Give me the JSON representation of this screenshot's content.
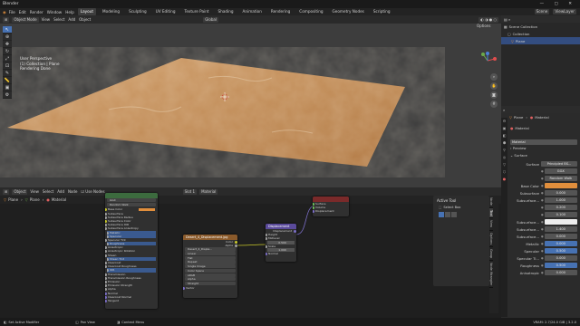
{
  "title": "Blender",
  "colors": {
    "accent": "#4772b3",
    "orange": "#e08e3c",
    "bg": "#3d3d3d",
    "node_shader": "#3c6b3e",
    "node_tex": "#8a5a2b",
    "node_vec": "#5a4a9a"
  },
  "menu": {
    "items": [
      "File",
      "Edit",
      "Render",
      "Window",
      "Help"
    ],
    "tabs": [
      "Layout",
      "Modeling",
      "Sculpting",
      "UV Editing",
      "Texture Paint",
      "Shading",
      "Animation",
      "Rendering",
      "Compositing",
      "Geometry Nodes",
      "Scripting"
    ],
    "active_tab": "Layout",
    "scene": "Scene",
    "view_layer": "ViewLayer"
  },
  "viewport": {
    "mode": "Object Mode",
    "menus": [
      "View",
      "Select",
      "Add",
      "Object"
    ],
    "orientation": "Global",
    "options": "Options",
    "info": [
      "User Perspective",
      "(1) Collection | Plane",
      "Rendering Done"
    ]
  },
  "tools": [
    "cursor-icon",
    "select-icon",
    "move-icon",
    "rotate-icon",
    "scale-icon",
    "transform-icon",
    "annotate-icon",
    "measure-icon",
    "add-icon",
    "settings-icon"
  ],
  "outliner": {
    "rows": [
      "Scene Collection",
      "Collection",
      "Plane"
    ],
    "selected": "Plane"
  },
  "properties": {
    "breadcrumb": [
      "Plane",
      "Material"
    ],
    "slot": "Material",
    "material": "Material",
    "panels": {
      "surface": "Surface",
      "preview": "Preview"
    },
    "surface_label": "Surface",
    "surface_value": "Principled BS...",
    "rows": [
      {
        "label": "",
        "value": "GGX"
      },
      {
        "label": "",
        "value": "Random Walk"
      },
      {
        "label": "Base Color",
        "value": ""
      },
      {
        "label": "Subsurface",
        "value": "0.000"
      },
      {
        "label": "Subsurface...",
        "value": "1.000"
      },
      {
        "label": "",
        "value": "0.200"
      },
      {
        "label": "",
        "value": "0.100"
      },
      {
        "label": "Subsurface...",
        "value": ""
      },
      {
        "label": "Subsurface...",
        "value": "1.400"
      },
      {
        "label": "Subsurface...",
        "value": "0.000"
      },
      {
        "label": "Metallic",
        "value": "0.000"
      },
      {
        "label": "Specular",
        "value": "0.500"
      },
      {
        "label": "Specular Ti...",
        "value": "0.000"
      },
      {
        "label": "Roughness",
        "value": "0.500"
      },
      {
        "label": "Anisotropic",
        "value": "0.000"
      }
    ]
  },
  "node_header": {
    "editor": "Object",
    "menus": [
      "View",
      "Select",
      "Add",
      "Node"
    ],
    "use_nodes": "Use Nodes",
    "slot": "Slot 1",
    "material": "Material"
  },
  "node_breadcrumb": [
    "Plane",
    "Plane",
    "Material"
  ],
  "nodes": {
    "bsdf": {
      "rows": [
        "GGX",
        "Random Walk",
        "Base Color",
        "Subsurface",
        "Subsurface Radius",
        "Subsurface Color",
        "Subsurface IOR",
        "Subsurface Anisotropy",
        "Metallic",
        "Specular",
        "Specular Tint",
        "Roughness",
        "Anisotropic",
        "Anisotropic Rotation",
        "Sheen",
        "Sheen Tint",
        "Clearcoat",
        "Clearcoat Roughness",
        "IOR",
        "Transmission",
        "Transmission Roughness",
        "Emission",
        "Emission Strength",
        "Alpha",
        "Normal",
        "Clearcoat Normal",
        "Tangent"
      ]
    },
    "output": {
      "rows": [
        "Surface",
        "Volume",
        "Displacement"
      ]
    },
    "texture": {
      "title": "Desert_4_Displacement.jpg",
      "rows": [
        "Color",
        "Alpha",
        "Desert_4_Displa...",
        "Linear",
        "Flat",
        "Repeat",
        "Single Image",
        "Color Space",
        "sRGB",
        "Alpha",
        "Straight",
        "Vector"
      ]
    },
    "mapping": {
      "title": "Displacement",
      "rows": [
        "Displacement",
        "Height",
        "Midlevel",
        "0.500",
        "Scale",
        "1.000",
        "Normal"
      ]
    }
  },
  "tool_panel": {
    "title": "Active Tool",
    "item": "Select Box"
  },
  "side_tabs": [
    "Node",
    "Tool",
    "View",
    "Options",
    "Group",
    "Node Wrangler"
  ],
  "status": [
    "Set Active Modifier",
    "Pan View",
    "Context Menu"
  ],
  "version": "VRAM: 2.7/24.0 GiB | 3.2.0"
}
